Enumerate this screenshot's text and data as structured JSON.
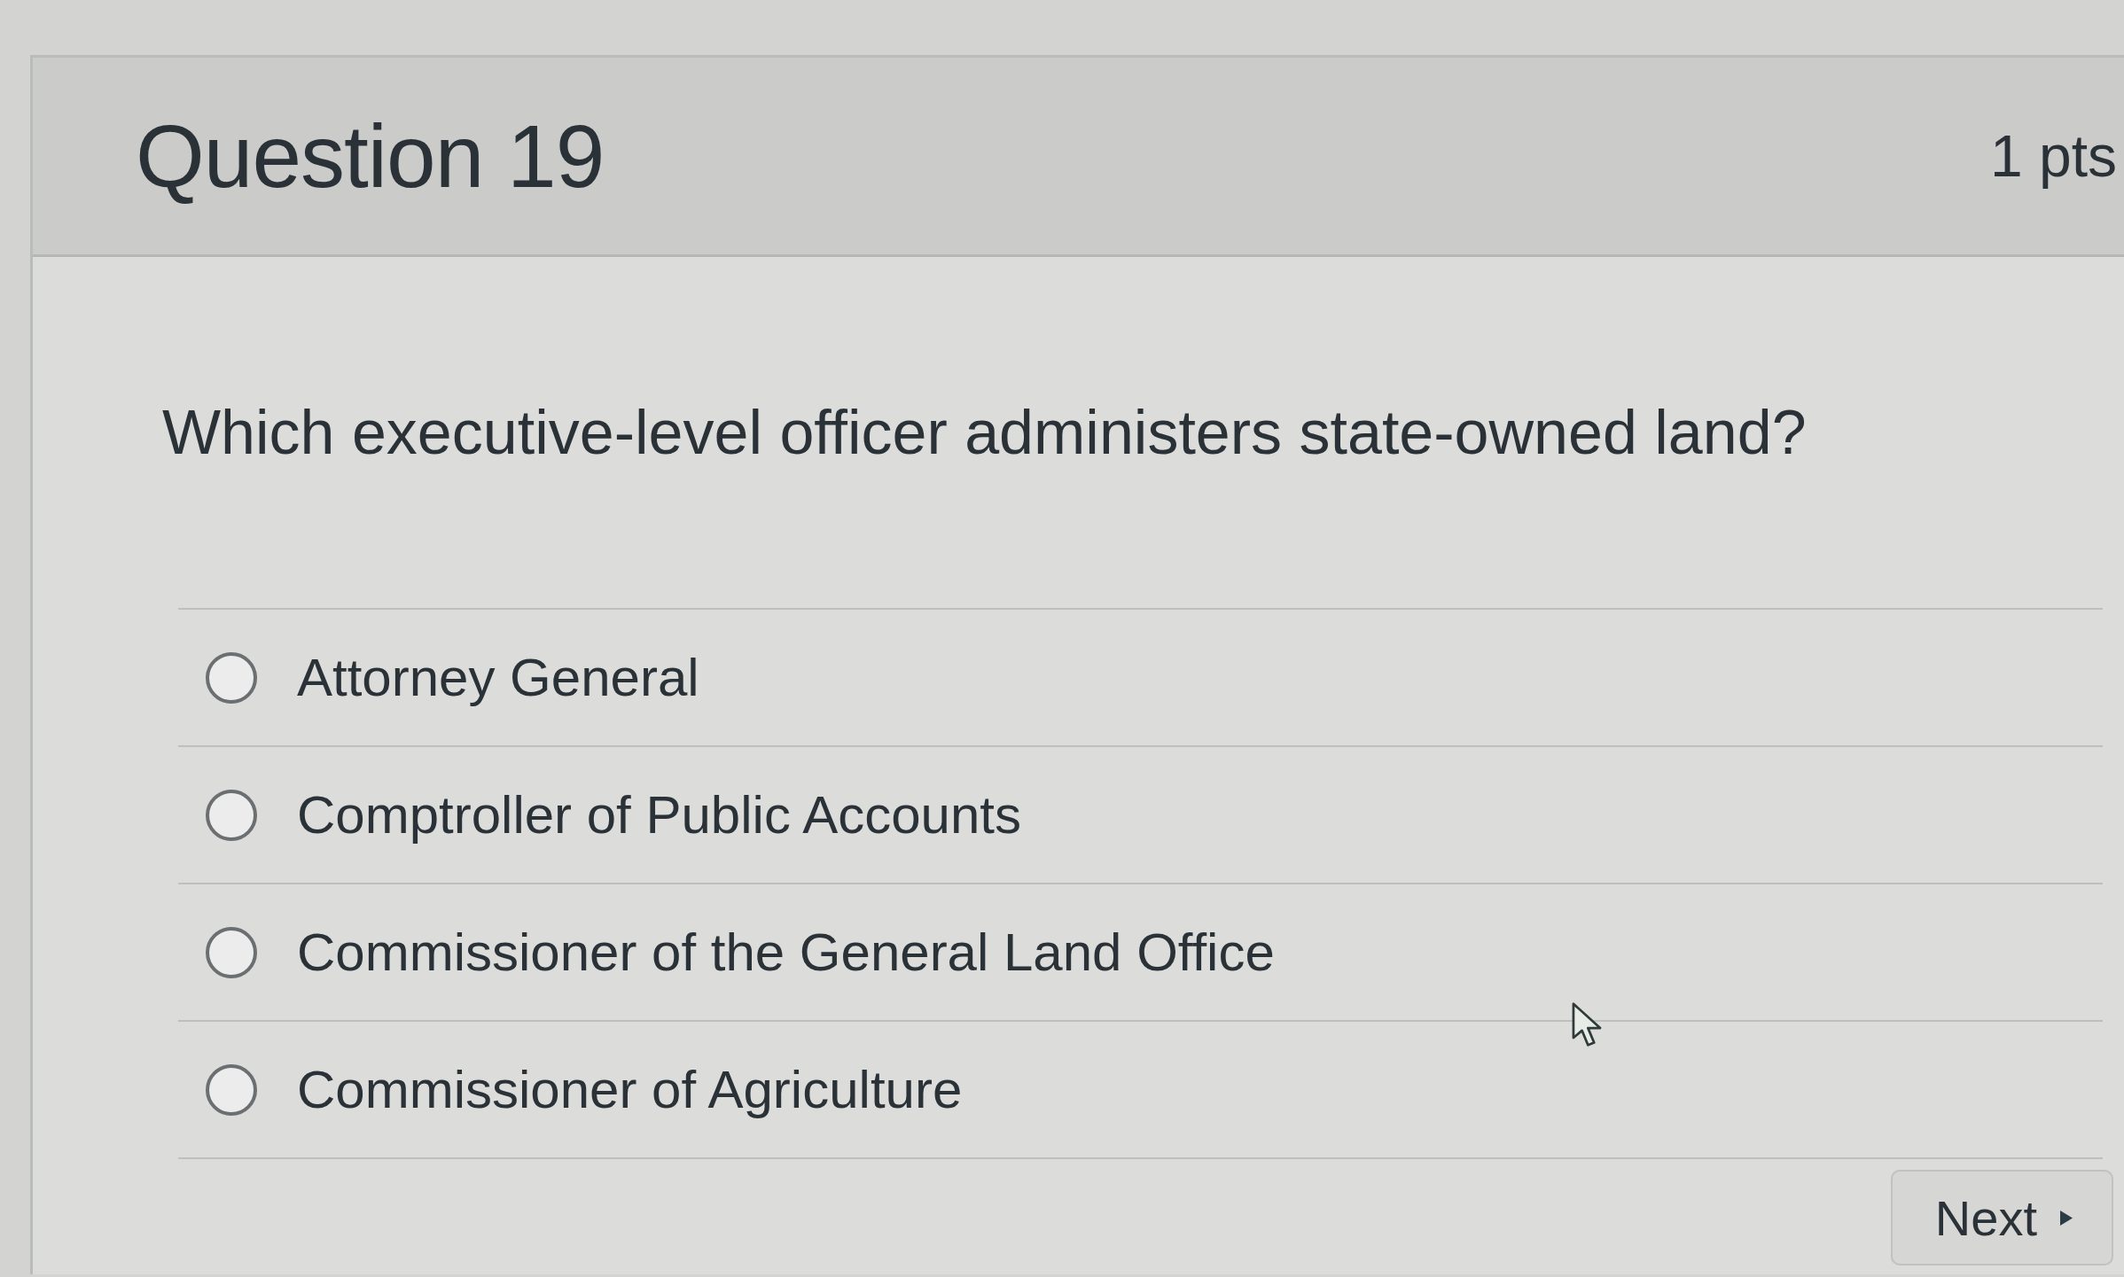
{
  "question": {
    "title": "Question 19",
    "points": "1 pts",
    "text": "Which executive-level officer administers state-owned land?"
  },
  "answers": [
    {
      "label": "Attorney General",
      "selected": false
    },
    {
      "label": "Comptroller of Public Accounts",
      "selected": false
    },
    {
      "label": "Commissioner of the General Land Office",
      "selected": false
    },
    {
      "label": "Commissioner of Agriculture",
      "selected": false
    }
  ],
  "buttons": {
    "next": {
      "label": "Next"
    }
  }
}
